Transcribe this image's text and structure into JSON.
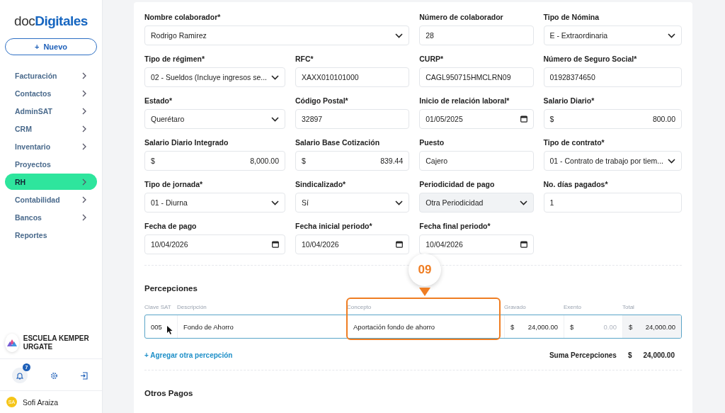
{
  "sidebar": {
    "logo": {
      "prefix": "doc",
      "brand": "Digitales"
    },
    "new_button": {
      "icon": "+",
      "label": "Nuevo"
    },
    "items": [
      {
        "label": "Facturación",
        "has_submenu": true,
        "selected": false
      },
      {
        "label": "Contactos",
        "has_submenu": true,
        "selected": false
      },
      {
        "label": "AdminSAT",
        "has_submenu": true,
        "selected": false
      },
      {
        "label": "CRM",
        "has_submenu": true,
        "selected": false
      },
      {
        "label": "Inventario",
        "has_submenu": true,
        "selected": false
      },
      {
        "label": "Proyectos",
        "has_submenu": false,
        "selected": false
      },
      {
        "label": "RH",
        "has_submenu": true,
        "selected": true
      },
      {
        "label": "Contabilidad",
        "has_submenu": true,
        "selected": false
      },
      {
        "label": "Bancos",
        "has_submenu": true,
        "selected": false
      },
      {
        "label": "Reportes",
        "has_submenu": false,
        "selected": false
      }
    ],
    "organization": "ESCUELA KEMPER URGATE",
    "notifications_badge": "7",
    "user": {
      "initials": "SA",
      "name": "Sofi Araiza"
    }
  },
  "form": {
    "fields": [
      {
        "label": "Nombre colaborador*",
        "kind": "select",
        "value": "Rodrigo Ramirez",
        "wide": true,
        "disabled": false
      },
      {
        "label": "Número de colaborador",
        "kind": "text",
        "value": "28",
        "wide": false,
        "disabled": false
      },
      {
        "label": "Tipo de Nómina",
        "kind": "select",
        "value": "E - Extraordinaria",
        "wide": false,
        "disabled": false
      },
      {
        "label": "Tipo de régimen*",
        "kind": "select",
        "value": "02 - Sueldos (Incluye ingresos se...",
        "wide": false,
        "disabled": false
      },
      {
        "label": "RFC*",
        "kind": "text",
        "value": "XAXX010101000",
        "wide": false,
        "disabled": false
      },
      {
        "label": "CURP*",
        "kind": "text",
        "value": "CAGL950715HMCLRN09",
        "wide": false,
        "disabled": false
      },
      {
        "label": "Número de Seguro Social*",
        "kind": "text",
        "value": "01928374650",
        "wide": false,
        "disabled": false
      },
      {
        "label": "Estado*",
        "kind": "select",
        "value": "Querétaro",
        "wide": false,
        "disabled": false
      },
      {
        "label": "Código Postal*",
        "kind": "text",
        "value": "32897",
        "wide": false,
        "disabled": false
      },
      {
        "label": "Inicio de relación laboral*",
        "kind": "date",
        "value": "01/05/2025",
        "wide": false,
        "disabled": false
      },
      {
        "label": "Salario Diario*",
        "kind": "money",
        "currency": "$",
        "value": "800.00",
        "wide": false,
        "disabled": false
      },
      {
        "label": "Salario Diario Integrado",
        "kind": "money",
        "currency": "$",
        "value": "8,000.00",
        "wide": false,
        "disabled": false
      },
      {
        "label": "Salario Base Cotización",
        "kind": "money",
        "currency": "$",
        "value": "839.44",
        "wide": false,
        "disabled": false
      },
      {
        "label": "Puesto",
        "kind": "text",
        "value": "Cajero",
        "wide": false,
        "disabled": false
      },
      {
        "label": "Tipo de contrato*",
        "kind": "select",
        "value": "01 - Contrato de trabajo por tiem...",
        "wide": false,
        "disabled": false
      },
      {
        "label": "Tipo de jornada*",
        "kind": "select",
        "value": "01 - Diurna",
        "wide": false,
        "disabled": false
      },
      {
        "label": "Sindicalizado*",
        "kind": "select",
        "value": "Sí",
        "wide": false,
        "disabled": false
      },
      {
        "label": "Periodicidad de pago",
        "kind": "select",
        "value": "Otra Periodicidad",
        "wide": false,
        "disabled": true
      },
      {
        "label": "No. días pagados*",
        "kind": "text",
        "value": "1",
        "wide": false,
        "disabled": false
      },
      {
        "label": "Fecha de pago",
        "kind": "date",
        "value": "10/04/2026",
        "wide": false,
        "disabled": false
      },
      {
        "label": "Fecha inicial periodo*",
        "kind": "date",
        "value": "10/04/2026",
        "wide": false,
        "disabled": false
      },
      {
        "label": "Fecha final periodo*",
        "kind": "date",
        "value": "10/04/2026",
        "wide": false,
        "disabled": false
      }
    ]
  },
  "percepciones": {
    "title": "Percepciones",
    "columns": [
      "Clave SAT",
      "Descripción",
      "Concepto",
      "Gravado",
      "Exento",
      "Total"
    ],
    "row": {
      "clave": "005",
      "descripcion": "Fondo de Ahorro",
      "concepto": "Aportación fondo de ahorro",
      "gravado": {
        "currency": "$",
        "value": "24,000.00"
      },
      "exento": {
        "currency": "$",
        "placeholder": "0.00"
      },
      "total": {
        "currency": "$",
        "value": "24,000.00"
      }
    },
    "add_link": "+ Agregar otra percepción",
    "sum": {
      "label": "Suma Percepciones",
      "currency": "$",
      "value": "24,000.00"
    }
  },
  "otros_pagos": {
    "title": "Otros Pagos"
  },
  "callout": {
    "label": "09"
  }
}
